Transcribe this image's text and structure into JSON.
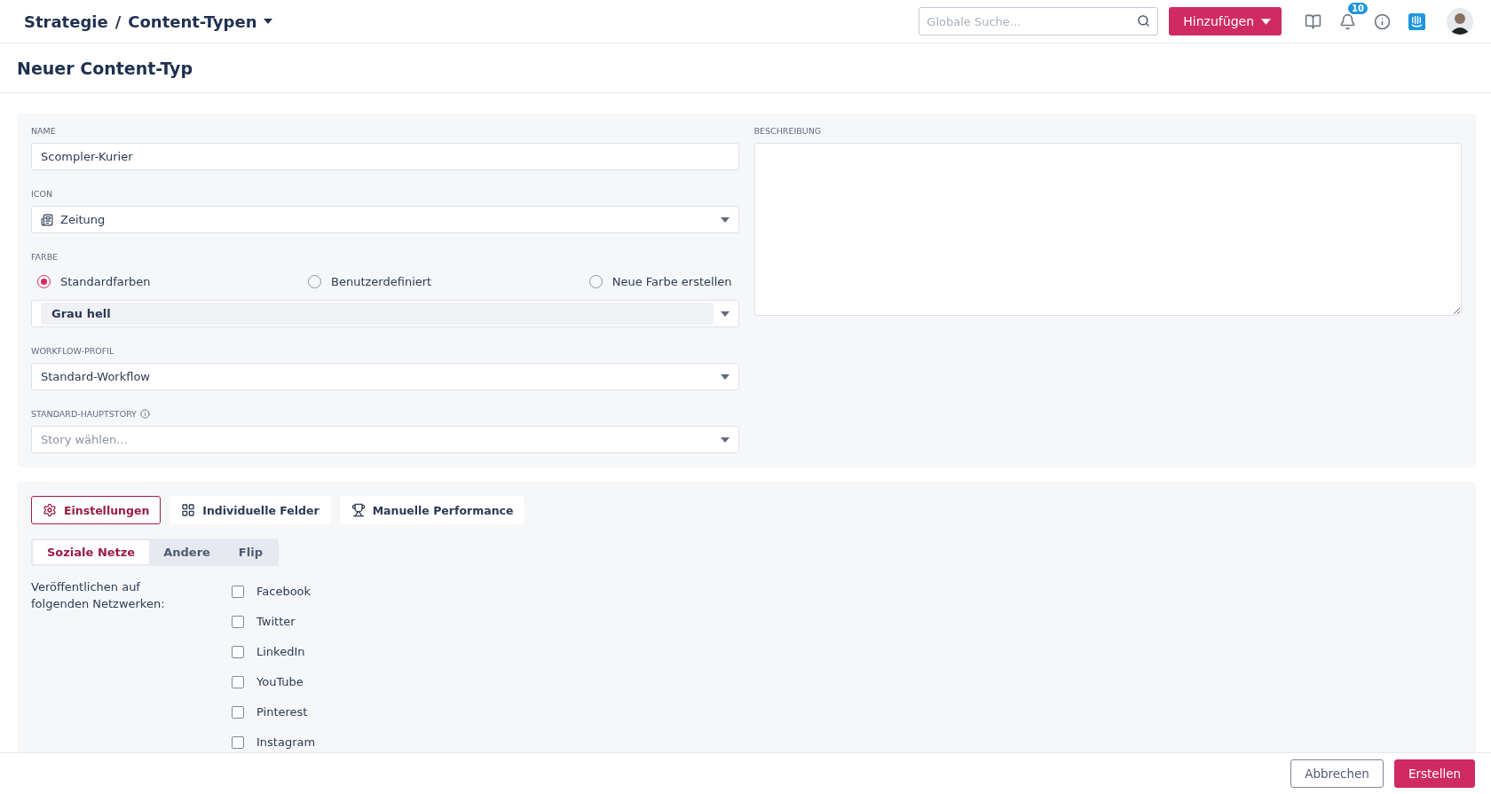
{
  "header": {
    "breadcrumb": [
      "Strategie",
      "Content-Typen"
    ],
    "separator": "/",
    "search": {
      "placeholder": "Globale Suche..."
    },
    "add_button": "Hinzufügen",
    "notification_count": "10"
  },
  "page_title": "Neuer Content-Typ",
  "form": {
    "name": {
      "label": "NAME",
      "value": "Scompler-Kurier"
    },
    "icon": {
      "label": "ICON",
      "value": "Zeitung"
    },
    "color": {
      "label": "FARBE",
      "options": [
        {
          "label": "Standardfarben",
          "selected": true
        },
        {
          "label": "Benutzerdefiniert",
          "selected": false
        },
        {
          "label": "Neue Farbe erstellen",
          "selected": false
        }
      ],
      "value": "Grau hell"
    },
    "workflow": {
      "label": "WORKFLOW-PROFIL",
      "value": "Standard-Workflow"
    },
    "main_story": {
      "label": "STANDARD-HAUPTSTORY",
      "placeholder": "Story wählen..."
    },
    "description": {
      "label": "BESCHREIBUNG"
    }
  },
  "section_buttons": [
    {
      "label": "Einstellungen",
      "selected": true
    },
    {
      "label": "Individuelle Felder",
      "selected": false
    },
    {
      "label": "Manuelle Performance",
      "selected": false
    }
  ],
  "tabs": [
    {
      "label": "Soziale Netze",
      "selected": true
    },
    {
      "label": "Andere",
      "selected": false
    },
    {
      "label": "Flip",
      "selected": false
    }
  ],
  "networks": {
    "label": "Veröffentlichen auf folgenden Netzwerken:",
    "items": [
      {
        "label": "Facebook",
        "checked": false
      },
      {
        "label": "Twitter",
        "checked": false
      },
      {
        "label": "LinkedIn",
        "checked": false
      },
      {
        "label": "YouTube",
        "checked": false
      },
      {
        "label": "Pinterest",
        "checked": false
      },
      {
        "label": "Instagram",
        "checked": false
      }
    ]
  },
  "footer_buttons": [
    {
      "label": "Abbrechen",
      "kind": "secondary"
    },
    {
      "label": "Erstellen",
      "kind": "primary"
    }
  ]
}
